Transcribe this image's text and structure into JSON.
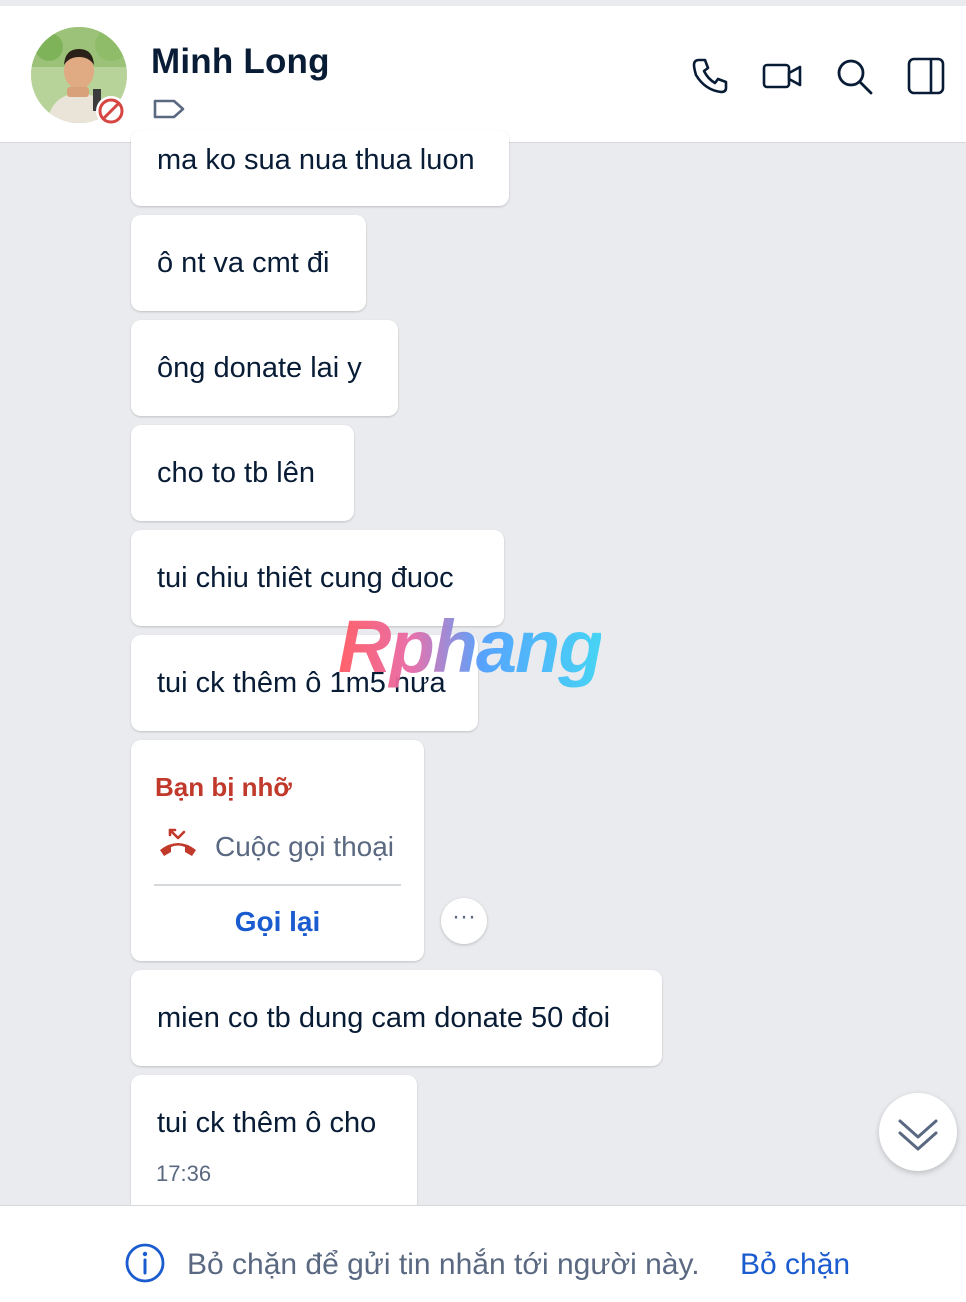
{
  "header": {
    "contact_name": "Minh Long"
  },
  "messages": [
    {
      "text": "ma ko sua nua thua luon"
    },
    {
      "text": "ô nt va cmt đi"
    },
    {
      "text": "ông donate lai y"
    },
    {
      "text": "cho to tb lên"
    },
    {
      "text": "tui chiu thiêt cung đuoc"
    },
    {
      "text": "tui ck thêm ô 1m5 nưa"
    },
    {
      "text": "mien co tb dung cam donate 50 đoi"
    },
    {
      "text": "tui ck thêm ô cho",
      "time": "17:36"
    }
  ],
  "call_card": {
    "title": "Bạn bị nhỡ",
    "call_type": "Cuộc gọi thoại",
    "callback_label": "Gọi lại"
  },
  "more_label": "···",
  "watermark": "Rphang",
  "footer": {
    "notice": "Bỏ chặn để gửi tin nhắn tới người này.",
    "unblock_label": "Bỏ chặn"
  },
  "colors": {
    "accent": "#1a5ccf",
    "missed_call": "#c0392b",
    "background": "#e9ebee",
    "text_primary": "#081c36",
    "text_secondary": "#5a6981"
  }
}
